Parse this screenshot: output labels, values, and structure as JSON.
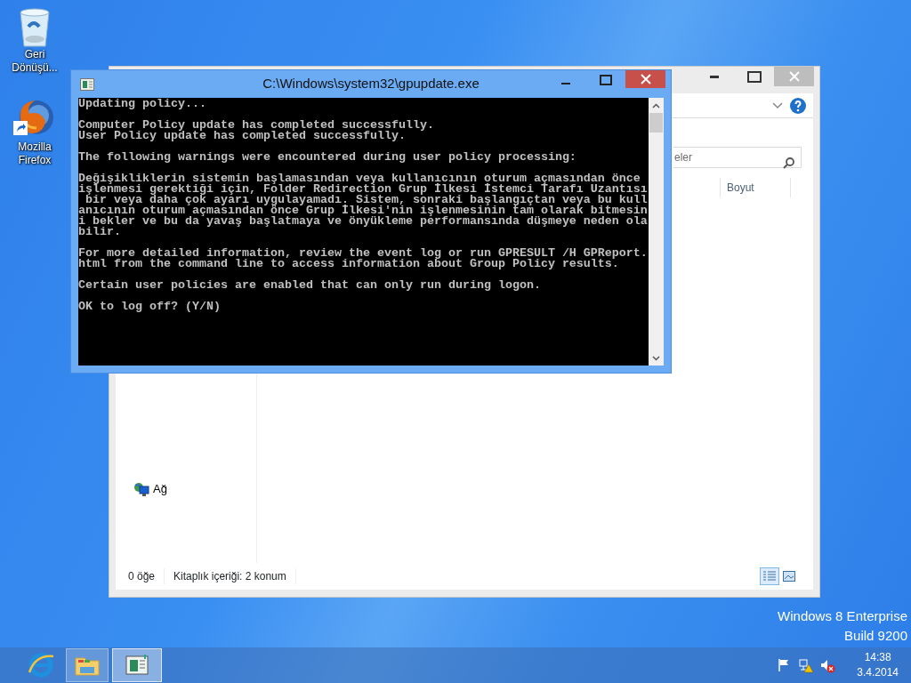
{
  "desktop_icons": [
    {
      "label": "Geri Dönüşü...",
      "kind": "recycle_bin",
      "shortcut": false
    },
    {
      "label": "Mozilla Firefox",
      "kind": "browser",
      "shortcut": true
    }
  ],
  "explorer": {
    "search": {
      "placeholder": "eler"
    },
    "columns": [
      "Boyut"
    ],
    "nav_items": [
      {
        "label": "Ağ",
        "kind": "network"
      }
    ],
    "status_bar": [
      "0 öğe",
      "Kitaplık içeriği: 2 konum"
    ],
    "view_buttons": [
      {
        "kind": "details",
        "selected": true
      },
      {
        "kind": "large_icons",
        "selected": false
      }
    ]
  },
  "console": {
    "title": "C:\\Windows\\system32\\gpupdate.exe",
    "paragraphs": [
      [
        "Updating policy..."
      ],
      [
        "Computer Policy update has completed successfully.",
        "User Policy update has completed successfully."
      ],
      [
        "The following warnings were encountered during user policy processing:"
      ],
      [
        "Değişikliklerin sistemin başlamasından veya kullanıcının oturum açmasından önce",
        "işlenmesi gerektiği için, Folder Redirection Grup İlkesi İstemci Tarafı Uzantısı",
        " bir veya daha çok ayarı uygulayamadı. Sistem, sonraki başlangıçtan veya bu kull",
        "anıcının oturum açmasından önce Grup İlkesi'nin işlenmesinin tam olarak bitmesin",
        "i bekler ve bu da yavaş başlatmaya ve önyükleme performansında düşmeye neden ola",
        "bilir."
      ],
      [
        "For more detailed information, review the event log or run GPRESULT /H GPReport.",
        "html from the command line to access information about Group Policy results."
      ],
      [
        "Certain user policies are enabled that can only run during logon."
      ],
      [
        "OK to log off? (Y/N)"
      ]
    ]
  },
  "os_edition": [
    "Windows 8 Enterprise",
    "Build 9200"
  ],
  "taskbar": {
    "apps": [
      {
        "kind": "browser",
        "running": false,
        "selected": false
      },
      {
        "kind": "file_explorer",
        "running": true,
        "selected": false
      },
      {
        "kind": "console",
        "running": true,
        "selected": true
      }
    ],
    "tray_icons": [
      {
        "kind": "flag"
      },
      {
        "kind": "network_warning"
      },
      {
        "kind": "volume_muted"
      }
    ],
    "time": "14:38",
    "date": "3.4.2014"
  }
}
